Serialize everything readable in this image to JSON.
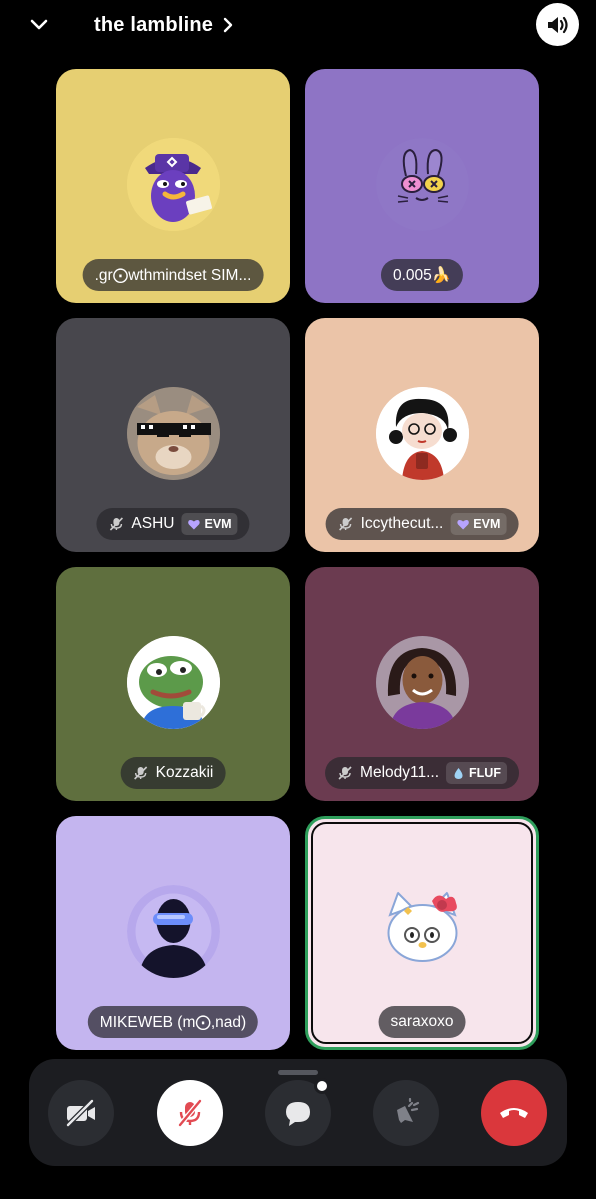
{
  "channel": {
    "title": "the lambline"
  },
  "participants": [
    {
      "name": ".gr⨀wthmindset SIM...",
      "muted": false,
      "tag": null,
      "bg": "#e6cf72",
      "speaking": false
    },
    {
      "name": "0.005🍌",
      "muted": false,
      "tag": null,
      "bg": "#8e74c5",
      "speaking": false
    },
    {
      "name": "ASHU",
      "muted": true,
      "tag": {
        "icon": "heart-icon",
        "label": "EVM"
      },
      "bg": "#48474d",
      "speaking": false
    },
    {
      "name": "Iccythecut...",
      "muted": true,
      "tag": {
        "icon": "heart-icon",
        "label": "EVM"
      },
      "bg": "#ebc4a8",
      "speaking": false
    },
    {
      "name": "Kozzakii",
      "muted": true,
      "tag": null,
      "bg": "#5f6f3e",
      "speaking": false
    },
    {
      "name": "Melody11...",
      "muted": true,
      "tag": {
        "icon": "droplet-icon",
        "label": "FLUF"
      },
      "bg": "#6b3b50",
      "speaking": false
    },
    {
      "name": "MIKEWEB (m⨀,nad)",
      "muted": false,
      "tag": null,
      "bg": "#c4b5ef",
      "speaking": false
    },
    {
      "name": "saraxoxo",
      "muted": false,
      "tag": null,
      "bg": "#f7e5ec",
      "speaking": true
    }
  ],
  "controls": {
    "camera": {
      "icon": "camera-off-icon",
      "state": "off"
    },
    "microphone": {
      "icon": "mic-off-icon",
      "state": "muted"
    },
    "chat": {
      "icon": "chat-bubble-icon",
      "has_notification": true
    },
    "soundboard": {
      "icon": "soundboard-icon"
    },
    "leave": {
      "icon": "hang-up-icon"
    }
  },
  "colors": {
    "speaking_ring": "#2e9e5b",
    "leave_red": "#da373c",
    "dock_bg": "#1c1d21"
  }
}
